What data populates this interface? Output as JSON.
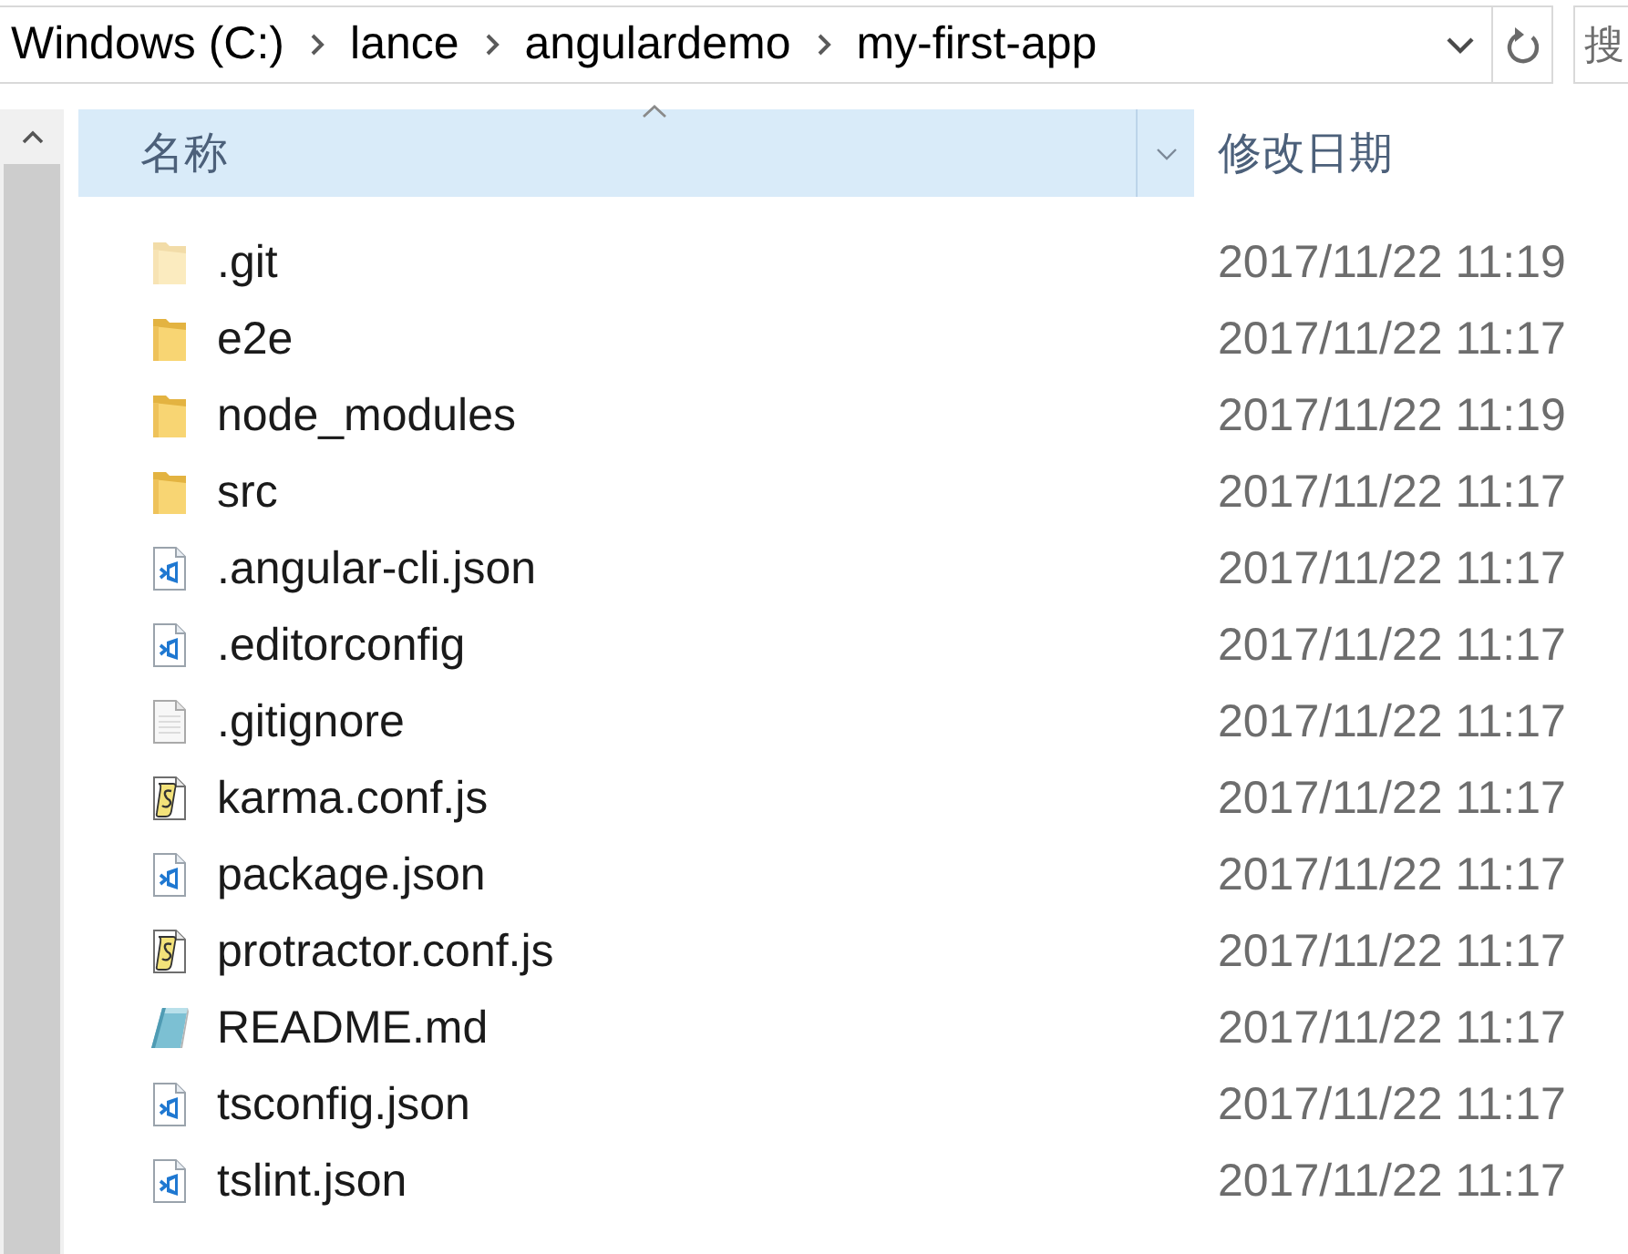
{
  "address_bar": {
    "breadcrumbs": [
      "Windows (C:)",
      "lance",
      "angulardemo",
      "my-first-app"
    ]
  },
  "search": {
    "placeholder": "搜"
  },
  "columns": [
    {
      "label": "名称",
      "hovered": true,
      "sorted": true
    },
    {
      "label": "修改日期",
      "hovered": false,
      "sorted": false
    }
  ],
  "files": [
    {
      "name": ".git",
      "kind": "folder",
      "hidden": true,
      "modified": "2017/11/22 11:19"
    },
    {
      "name": "e2e",
      "kind": "folder",
      "hidden": false,
      "modified": "2017/11/22 11:17"
    },
    {
      "name": "node_modules",
      "kind": "folder",
      "hidden": false,
      "modified": "2017/11/22 11:19"
    },
    {
      "name": "src",
      "kind": "folder",
      "hidden": false,
      "modified": "2017/11/22 11:17"
    },
    {
      "name": ".angular-cli.json",
      "kind": "vscode",
      "hidden": false,
      "modified": "2017/11/22 11:17"
    },
    {
      "name": ".editorconfig",
      "kind": "vscode",
      "hidden": false,
      "modified": "2017/11/22 11:17"
    },
    {
      "name": ".gitignore",
      "kind": "text",
      "hidden": false,
      "modified": "2017/11/22 11:17"
    },
    {
      "name": "karma.conf.js",
      "kind": "script",
      "hidden": false,
      "modified": "2017/11/22 11:17"
    },
    {
      "name": "package.json",
      "kind": "vscode",
      "hidden": false,
      "modified": "2017/11/22 11:17"
    },
    {
      "name": "protractor.conf.js",
      "kind": "script",
      "hidden": false,
      "modified": "2017/11/22 11:17"
    },
    {
      "name": "README.md",
      "kind": "notepad",
      "hidden": false,
      "modified": "2017/11/22 11:17"
    },
    {
      "name": "tsconfig.json",
      "kind": "vscode",
      "hidden": false,
      "modified": "2017/11/22 11:17"
    },
    {
      "name": "tslint.json",
      "kind": "vscode",
      "hidden": false,
      "modified": "2017/11/22 11:17"
    }
  ]
}
